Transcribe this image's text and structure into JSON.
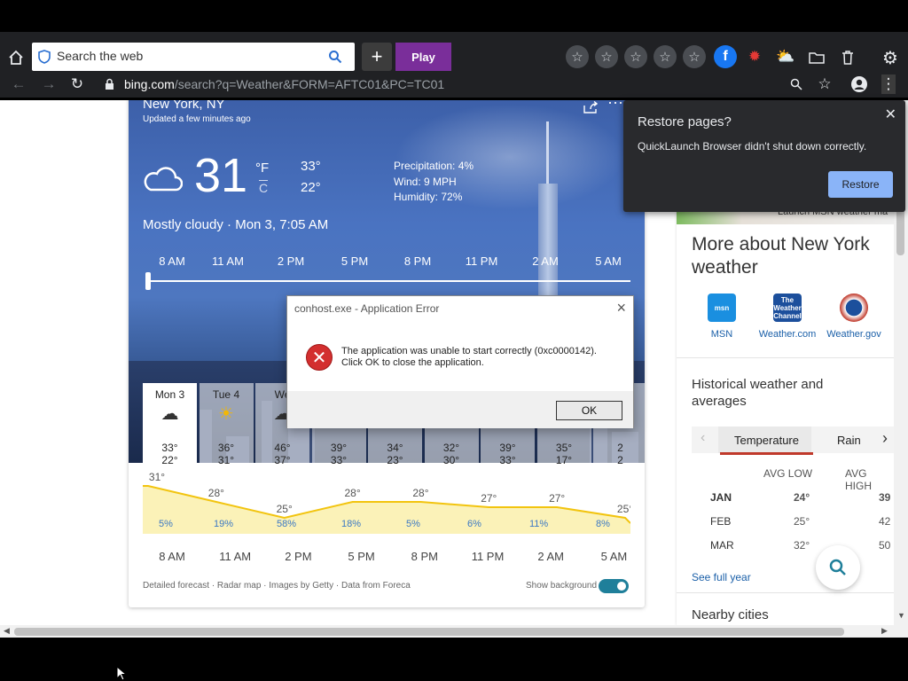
{
  "browser": {
    "search_placeholder": "Search the web",
    "play_label": "Play",
    "url_host": "bing.com",
    "url_rest": "/search?q=Weather&FORM=AFTC01&PC=TC01"
  },
  "restore": {
    "title": "Restore pages?",
    "message": "QuickLaunch Browser didn't shut down correctly.",
    "button": "Restore"
  },
  "error_dialog": {
    "title": "conhost.exe - Application Error",
    "line1": "The application was unable to start correctly (0xc0000142).",
    "line2": "Click OK to close the application.",
    "ok": "OK"
  },
  "weather": {
    "location": "New York, NY",
    "updated": "Updated a few minutes ago",
    "temp": "31",
    "unit_f": "°F",
    "unit_c": "C",
    "hi": "33°",
    "lo": "22°",
    "precip": "Precipitation: 4%",
    "wind": "Wind: 9 MPH",
    "humidity": "Humidity: 72%",
    "condition": "Mostly cloudy · Mon 3, 7:05 AM",
    "hours": [
      "8 AM",
      "11 AM",
      "2 PM",
      "5 PM",
      "8 PM",
      "11 PM",
      "2 AM",
      "5 AM"
    ],
    "days": [
      {
        "name": "Mon 3",
        "hi": "33°",
        "lo": "22°"
      },
      {
        "name": "Tue 4",
        "hi": "36°",
        "lo": "31°"
      },
      {
        "name": "We",
        "hi": "46°",
        "lo": "37°"
      },
      {
        "name": "",
        "hi": "39°",
        "lo": "33°"
      },
      {
        "name": "",
        "hi": "34°",
        "lo": "23°"
      },
      {
        "name": "",
        "hi": "32°",
        "lo": "30°"
      },
      {
        "name": "",
        "hi": "39°",
        "lo": "33°"
      },
      {
        "name": "",
        "hi": "35°",
        "lo": "17°"
      },
      {
        "name": "",
        "hi": "2",
        "lo": "2"
      }
    ],
    "hourly_temps": [
      "31°",
      "28°",
      "25°",
      "28°",
      "28°",
      "27°",
      "27°",
      "25°"
    ],
    "hourly_precip": [
      "5%",
      "19%",
      "58%",
      "18%",
      "5%",
      "6%",
      "11%",
      "8%"
    ],
    "footer": "Detailed forecast · Radar map · Images by Getty · Data from Foreca",
    "show_background": "Show background"
  },
  "side": {
    "banner_text": "Launch MSN weather ma",
    "more_title": "More about New York weather",
    "sources": [
      {
        "name": "MSN",
        "logo": "msn"
      },
      {
        "name": "Weather.com",
        "logo": "The Weather Channel"
      },
      {
        "name": "Weather.gov",
        "logo": ""
      }
    ],
    "hist_title": "Historical weather and averages",
    "tabs": [
      "Temperature",
      "Rain"
    ],
    "col_low": "AVG LOW",
    "col_high": "AVG HIGH",
    "months": [
      {
        "m": "JAN",
        "low": "24°",
        "high": "39"
      },
      {
        "m": "FEB",
        "low": "25°",
        "high": "42"
      },
      {
        "m": "MAR",
        "low": "32°",
        "high": "50"
      }
    ],
    "see_full_year": "See full year",
    "nearby": "Nearby cities"
  },
  "chart_data": {
    "type": "area",
    "x": [
      "8 AM",
      "11 AM",
      "2 PM",
      "5 PM",
      "8 PM",
      "11 PM",
      "2 AM",
      "5 AM"
    ],
    "series": [
      {
        "values": [
          31,
          28,
          25,
          28,
          28,
          27,
          27,
          25
        ]
      }
    ],
    "ylabel": "",
    "xlabel": ""
  }
}
